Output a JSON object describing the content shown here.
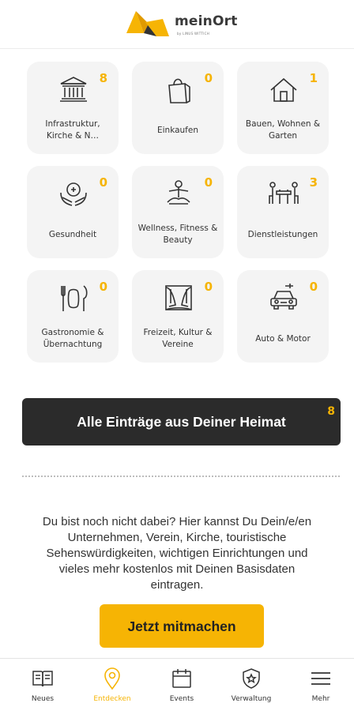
{
  "brand": {
    "name": "meinOrt",
    "sub": "by LINUS WITTICH"
  },
  "categories": [
    {
      "label": "Infrastruktur, Kirche & N…",
      "count": "8",
      "icon": "building-icon"
    },
    {
      "label": "Einkaufen",
      "count": "0",
      "icon": "shopping-bag-icon"
    },
    {
      "label": "Bauen, Wohnen & Garten",
      "count": "1",
      "icon": "house-icon"
    },
    {
      "label": "Gesundheit",
      "count": "0",
      "icon": "health-hands-icon"
    },
    {
      "label": "Wellness, Fitness & Beauty",
      "count": "0",
      "icon": "meditation-icon"
    },
    {
      "label": "Dienstleistungen",
      "count": "3",
      "icon": "table-people-icon"
    },
    {
      "label": "Gastronomie & Übernachtung",
      "count": "0",
      "icon": "cutlery-icon"
    },
    {
      "label": "Freizeit, Kultur & Vereine",
      "count": "0",
      "icon": "theater-curtain-icon"
    },
    {
      "label": "Auto & Motor",
      "count": "0",
      "icon": "car-icon"
    }
  ],
  "all_entries": {
    "label": "Alle Einträge aus Deiner Heimat",
    "count": "8"
  },
  "invite": {
    "text": "Du bist noch nicht dabei? Hier kannst Du Dein/e/en Unternehmen, Verein, Kirche, touristische Sehenswürdigkeiten, wichtigen Einrichtungen und vieles mehr kostenlos mit Deinen Basisdaten eintragen.",
    "button": "Jetzt mitmachen"
  },
  "tabs": [
    {
      "label": "Neues",
      "icon": "newspaper-icon",
      "active": false
    },
    {
      "label": "Entdecken",
      "icon": "map-pin-icon",
      "active": true
    },
    {
      "label": "Events",
      "icon": "calendar-icon",
      "active": false
    },
    {
      "label": "Verwaltung",
      "icon": "shield-icon",
      "active": false
    },
    {
      "label": "Mehr",
      "icon": "menu-icon",
      "active": false
    }
  ],
  "colors": {
    "accent": "#f6b404",
    "dark_button": "#2b2b2b",
    "tile_bg": "#f4f4f4"
  }
}
